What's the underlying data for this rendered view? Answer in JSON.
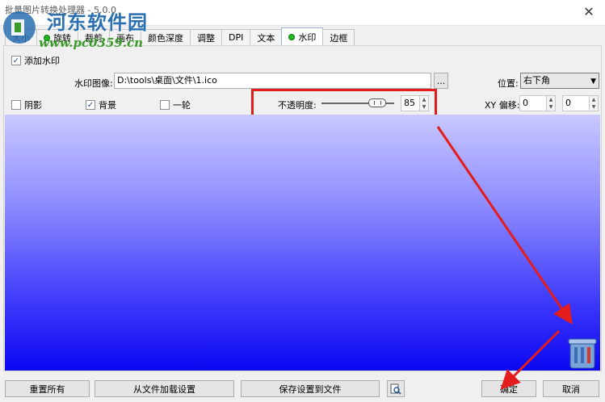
{
  "window": {
    "title": "批量图片转换处理器 - 5.0.0",
    "close_glyph": "✕"
  },
  "overlay": {
    "site_name": "河东软件园",
    "site_url": "www.pc0359.cn"
  },
  "tabs": [
    {
      "label": "大小",
      "dot": false
    },
    {
      "label": "旋转",
      "dot": true
    },
    {
      "label": "裁剪",
      "dot": false
    },
    {
      "label": "画布",
      "dot": false
    },
    {
      "label": "颜色深度",
      "dot": false
    },
    {
      "label": "调整",
      "dot": false
    },
    {
      "label": "DPI",
      "dot": false
    },
    {
      "label": "文本",
      "dot": false
    },
    {
      "label": "水印",
      "dot": true,
      "active": true
    },
    {
      "label": "边框",
      "dot": false
    }
  ],
  "watermark": {
    "enable_label": "添加水印",
    "enable_checked": true,
    "image_label": "水印图像:",
    "image_path": "D:\\tools\\桌面\\文件\\1.ico",
    "browse_label": "...",
    "position_label": "位置:",
    "position_value": "右下角",
    "shadow_label": "阴影",
    "shadow_checked": false,
    "background_label": "背景",
    "background_checked": true,
    "round_label": "一轮",
    "round_checked": false,
    "opacity_label": "不透明度:",
    "opacity_value": "85",
    "xy_label": "XY 偏移:",
    "x_offset": "0",
    "y_offset": "0"
  },
  "buttons": {
    "reset_all": "重置所有",
    "load_settings": "从文件加载设置",
    "save_settings": "保存设置到文件",
    "ok": "确定",
    "cancel": "取消"
  },
  "colors": {
    "highlight": "#e31c1c",
    "preview_top": "#c9c8ff",
    "preview_bottom": "#0c07f2",
    "active_dot": "#1fb81f"
  },
  "icons": {
    "preview": "preview-magnifier-icon",
    "watermark_thumb": "recycle-bin-icon"
  }
}
